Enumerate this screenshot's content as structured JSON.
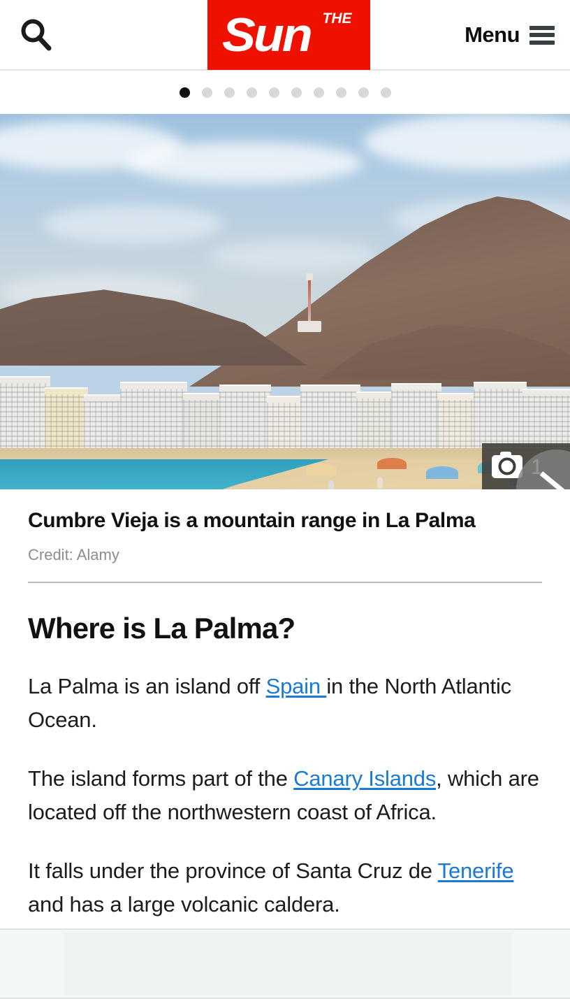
{
  "header": {
    "search_icon": "search-icon",
    "logo_main": "Sun",
    "logo_the": "THE",
    "menu_label": "Menu",
    "menu_icon": "hamburger-icon",
    "brand_color": "#ee1100"
  },
  "carousel": {
    "total_dots": 10,
    "active_index": 0
  },
  "hero": {
    "photo_counter": "1",
    "camera_icon": "camera-icon",
    "next_icon": "chevron-right-icon",
    "caption_title": "Cumbre Vieja is a mountain range in La Palma",
    "caption_credit": "Credit: Alamy"
  },
  "article": {
    "heading": "Where is La Palma?",
    "paragraphs": [
      {
        "before": "La Palma is an island off ",
        "link": "Spain ",
        "after": "in the North Atlantic Ocean."
      },
      {
        "before": "The island forms part of the ",
        "link": "Canary Islands",
        "after": ", which are located off the northwestern coast of Africa."
      },
      {
        "before": "It falls under the province of Santa Cruz de ",
        "link": "Tenerife",
        "after": " and has a large volcanic caldera."
      }
    ],
    "link_color": "#1a7ad4"
  },
  "sticky_bottom": {
    "label": ""
  }
}
